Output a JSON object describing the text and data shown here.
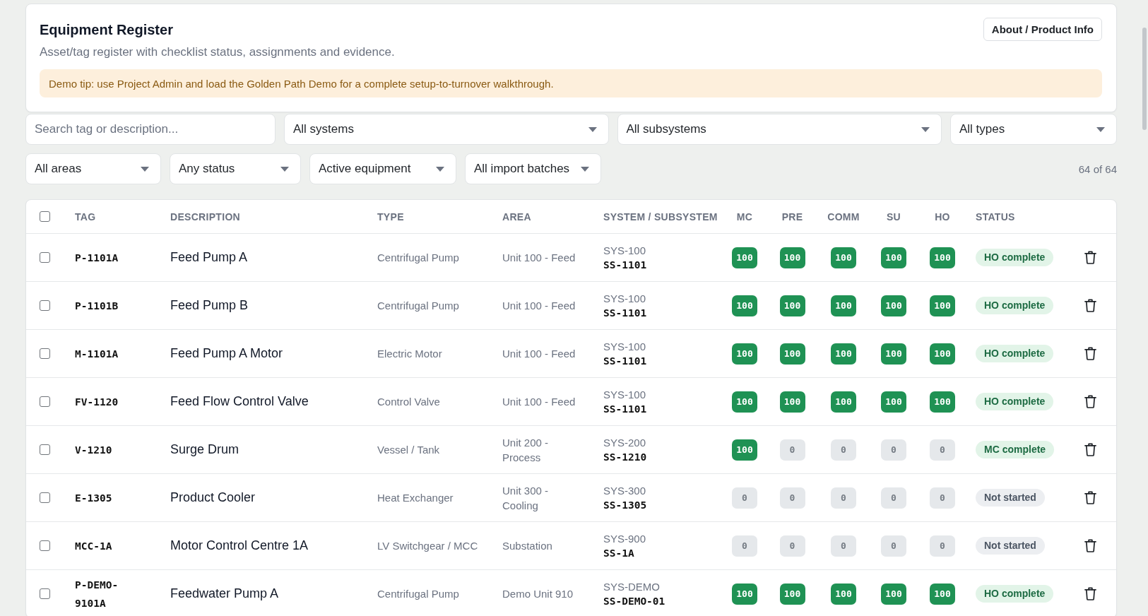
{
  "header": {
    "title": "Equipment Register",
    "about_button": "About / Product Info",
    "subtitle": "Asset/tag register with checklist status, assignments and evidence.",
    "tip": "Demo tip: use Project Admin and load the Golden Path Demo for a complete setup-to-turnover walkthrough."
  },
  "filters": {
    "search": {
      "placeholder": "Search tag or description..."
    },
    "row_1": [
      {
        "value": "All systems"
      },
      {
        "value": "All subsystems"
      },
      {
        "value": "All types"
      }
    ],
    "row_2": [
      {
        "value": "All areas"
      },
      {
        "value": "Any status"
      },
      {
        "value": "Active equipment"
      },
      {
        "value": "All import batches"
      }
    ],
    "count": "64 of 64"
  },
  "table": {
    "select_all_checked": false,
    "columns": [
      {
        "label": "TAG",
        "kind": "text"
      },
      {
        "label": "DESCRIPTION",
        "kind": "text"
      },
      {
        "label": "TYPE",
        "kind": "text"
      },
      {
        "label": "AREA",
        "kind": "text"
      },
      {
        "label": "SYSTEM / SUBSYSTEM",
        "kind": "text"
      },
      {
        "label": "MC",
        "kind": "check"
      },
      {
        "label": "PRE",
        "kind": "check"
      },
      {
        "label": "COMM",
        "kind": "check"
      },
      {
        "label": "SU",
        "kind": "check"
      },
      {
        "label": "HO",
        "kind": "check"
      },
      {
        "label": "STATUS",
        "kind": "status"
      }
    ],
    "rows": [
      {
        "checked": false,
        "tag": "P-1101A",
        "description": "Feed Pump A",
        "type": "Centrifugal Pump",
        "area": "Unit 100 - Feed",
        "system": "SYS-100",
        "subsystem": "SS-1101",
        "checks": [
          {
            "value": "100",
            "complete": true
          },
          {
            "value": "100",
            "complete": true
          },
          {
            "value": "100",
            "complete": true
          },
          {
            "value": "100",
            "complete": true
          },
          {
            "value": "100",
            "complete": true
          }
        ],
        "status": {
          "label": "HO complete",
          "kind": "complete"
        }
      },
      {
        "checked": false,
        "tag": "P-1101B",
        "description": "Feed Pump B",
        "type": "Centrifugal Pump",
        "area": "Unit 100 - Feed",
        "system": "SYS-100",
        "subsystem": "SS-1101",
        "checks": [
          {
            "value": "100",
            "complete": true
          },
          {
            "value": "100",
            "complete": true
          },
          {
            "value": "100",
            "complete": true
          },
          {
            "value": "100",
            "complete": true
          },
          {
            "value": "100",
            "complete": true
          }
        ],
        "status": {
          "label": "HO complete",
          "kind": "complete"
        }
      },
      {
        "checked": false,
        "tag": "M-1101A",
        "description": "Feed Pump A Motor",
        "type": "Electric Motor",
        "area": "Unit 100 - Feed",
        "system": "SYS-100",
        "subsystem": "SS-1101",
        "checks": [
          {
            "value": "100",
            "complete": true
          },
          {
            "value": "100",
            "complete": true
          },
          {
            "value": "100",
            "complete": true
          },
          {
            "value": "100",
            "complete": true
          },
          {
            "value": "100",
            "complete": true
          }
        ],
        "status": {
          "label": "HO complete",
          "kind": "complete"
        }
      },
      {
        "checked": false,
        "tag": "FV-1120",
        "description": "Feed Flow Control Valve",
        "type": "Control Valve",
        "area": "Unit 100 - Feed",
        "system": "SYS-100",
        "subsystem": "SS-1101",
        "checks": [
          {
            "value": "100",
            "complete": true
          },
          {
            "value": "100",
            "complete": true
          },
          {
            "value": "100",
            "complete": true
          },
          {
            "value": "100",
            "complete": true
          },
          {
            "value": "100",
            "complete": true
          }
        ],
        "status": {
          "label": "HO complete",
          "kind": "complete"
        }
      },
      {
        "checked": false,
        "tag": "V-1210",
        "description": "Surge Drum",
        "type": "Vessel / Tank",
        "area": "Unit 200 - Process",
        "system": "SYS-200",
        "subsystem": "SS-1210",
        "checks": [
          {
            "value": "100",
            "complete": true
          },
          {
            "value": "0",
            "complete": false
          },
          {
            "value": "0",
            "complete": false
          },
          {
            "value": "0",
            "complete": false
          },
          {
            "value": "0",
            "complete": false
          }
        ],
        "status": {
          "label": "MC complete",
          "kind": "complete"
        }
      },
      {
        "checked": false,
        "tag": "E-1305",
        "description": "Product Cooler",
        "type": "Heat Exchanger",
        "area": "Unit 300 - Cooling",
        "system": "SYS-300",
        "subsystem": "SS-1305",
        "checks": [
          {
            "value": "0",
            "complete": false
          },
          {
            "value": "0",
            "complete": false
          },
          {
            "value": "0",
            "complete": false
          },
          {
            "value": "0",
            "complete": false
          },
          {
            "value": "0",
            "complete": false
          }
        ],
        "status": {
          "label": "Not started",
          "kind": "not_started"
        }
      },
      {
        "checked": false,
        "tag": "MCC-1A",
        "description": "Motor Control Centre 1A",
        "type": "LV Switchgear / MCC",
        "area": "Substation",
        "system": "SYS-900",
        "subsystem": "SS-1A",
        "checks": [
          {
            "value": "0",
            "complete": false
          },
          {
            "value": "0",
            "complete": false
          },
          {
            "value": "0",
            "complete": false
          },
          {
            "value": "0",
            "complete": false
          },
          {
            "value": "0",
            "complete": false
          }
        ],
        "status": {
          "label": "Not started",
          "kind": "not_started"
        }
      },
      {
        "checked": false,
        "tag": "P-DEMO-9101A",
        "description": "Feedwater Pump A",
        "type": "Centrifugal Pump",
        "area": "Demo Unit 910",
        "system": "SYS-DEMO",
        "subsystem": "SS-DEMO-01",
        "checks": [
          {
            "value": "100",
            "complete": true
          },
          {
            "value": "100",
            "complete": true
          },
          {
            "value": "100",
            "complete": true
          },
          {
            "value": "100",
            "complete": true
          },
          {
            "value": "100",
            "complete": true
          }
        ],
        "status": {
          "label": "HO complete",
          "kind": "complete"
        }
      }
    ]
  }
}
